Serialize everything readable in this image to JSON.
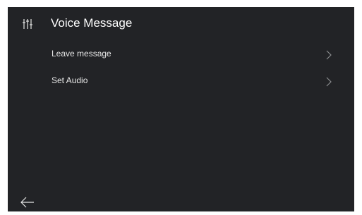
{
  "header": {
    "icon": "equalizer-sliders-icon",
    "title": "Voice Message"
  },
  "menu": {
    "items": [
      {
        "label": "Leave message",
        "icon": "chevron-right-icon"
      },
      {
        "label": "Set Audio",
        "icon": "chevron-right-icon"
      }
    ]
  },
  "footer": {
    "back_icon": "arrow-left-icon"
  },
  "colors": {
    "background": "#222326",
    "text": "#e6e6e6",
    "chevron": "#8a8b8e"
  }
}
